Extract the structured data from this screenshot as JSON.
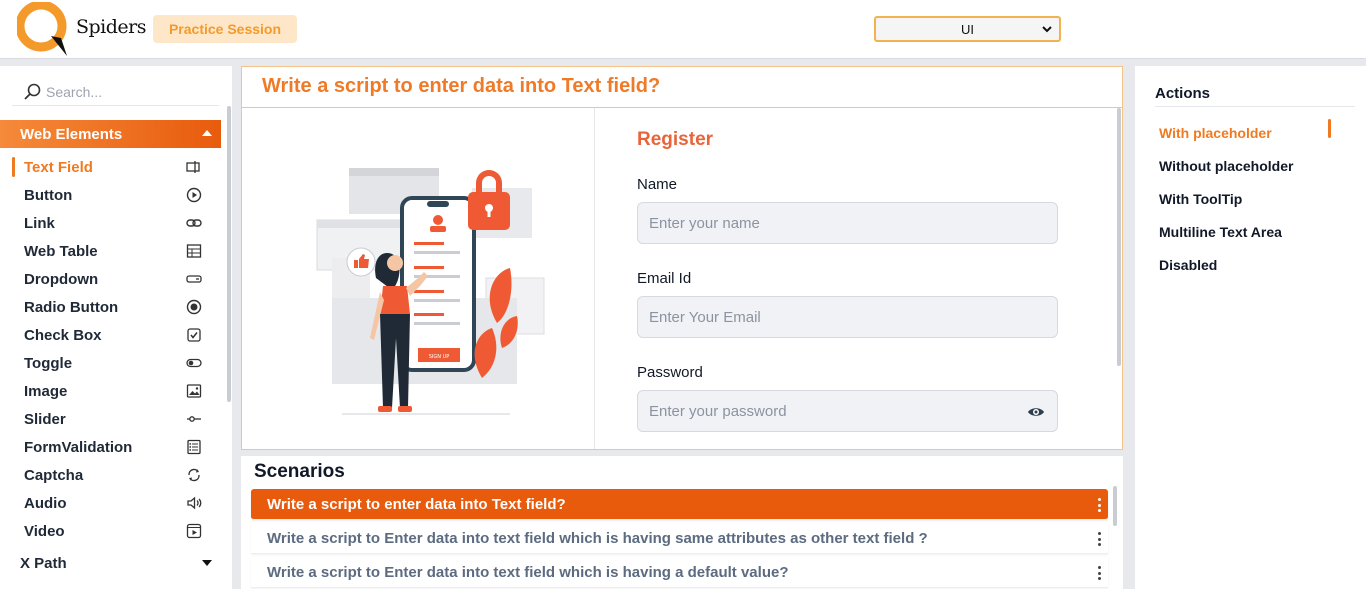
{
  "header": {
    "logo_text": "Spiders",
    "badge": "Practice Session",
    "select_value": "UI"
  },
  "sidebar": {
    "search_placeholder": "Search...",
    "group_label": "Web Elements",
    "items": [
      {
        "label": "Text Field",
        "icon": "text-field-icon"
      },
      {
        "label": "Button",
        "icon": "play-circle-icon"
      },
      {
        "label": "Link",
        "icon": "link-icon"
      },
      {
        "label": "Web Table",
        "icon": "table-icon"
      },
      {
        "label": "Dropdown",
        "icon": "dropdown-icon"
      },
      {
        "label": "Radio Button",
        "icon": "radio-icon"
      },
      {
        "label": "Check Box",
        "icon": "checkbox-icon"
      },
      {
        "label": "Toggle",
        "icon": "toggle-icon"
      },
      {
        "label": "Image",
        "icon": "image-icon"
      },
      {
        "label": "Slider",
        "icon": "slider-icon"
      },
      {
        "label": "FormValidation",
        "icon": "form-icon"
      },
      {
        "label": "Captcha",
        "icon": "captcha-icon"
      },
      {
        "label": "Audio",
        "icon": "audio-icon"
      },
      {
        "label": "Video",
        "icon": "video-icon"
      }
    ],
    "xpath_label": "X Path"
  },
  "main": {
    "title": "Write a script to enter data into Text field?",
    "form": {
      "heading": "Register",
      "name_label": "Name",
      "name_placeholder": "Enter your name",
      "email_label": "Email Id",
      "email_placeholder": "Enter Your Email",
      "password_label": "Password",
      "password_placeholder": "Enter your password"
    },
    "illustration_button": "SIGN UP"
  },
  "scenarios": {
    "title": "Scenarios",
    "items": [
      "Write a script to enter data into Text field?",
      "Write a script to Enter data into text field which is having same attributes as other text field ?",
      "Write a script to Enter data into text field which is having a default value?"
    ]
  },
  "actions": {
    "title": "Actions",
    "items": [
      "With placeholder",
      "Without placeholder",
      "With ToolTip",
      "Multiline Text Area",
      "Disabled"
    ]
  },
  "colors": {
    "accent": "#f07a22",
    "accent_dark": "#e85b0d",
    "badge_bg": "#fde7c8",
    "register": "#e8643a"
  }
}
